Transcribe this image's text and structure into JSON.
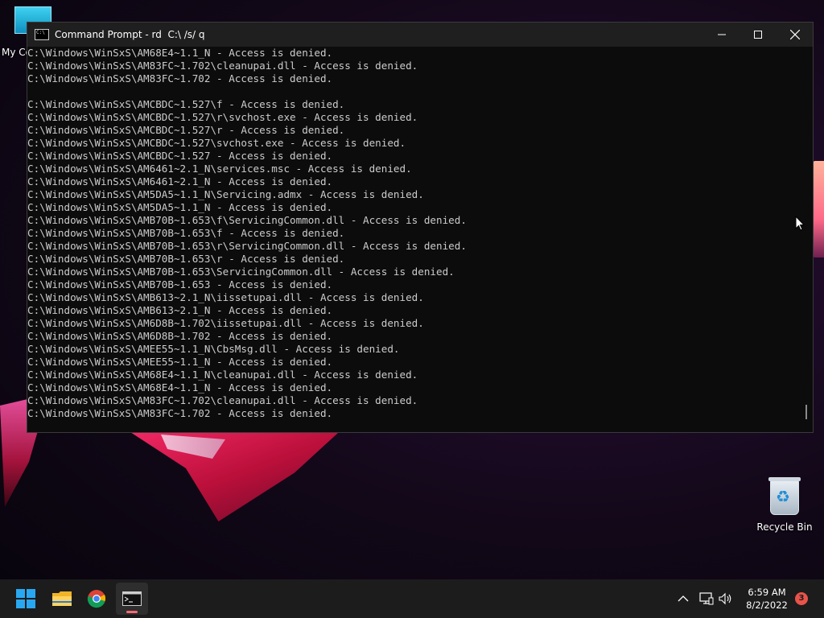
{
  "desktop": {
    "icons": [
      {
        "label": "My Co"
      },
      {
        "label": "Recycle Bin"
      }
    ]
  },
  "window": {
    "title": "Command Prompt - rd  C:\\ /s/ q",
    "console_lines": [
      "C:\\Windows\\WinSxS\\AM68E4~1.1_N - Access is denied.",
      "C:\\Windows\\WinSxS\\AM83FC~1.702\\cleanupai.dll - Access is denied.",
      "C:\\Windows\\WinSxS\\AM83FC~1.702 - Access is denied.",
      "",
      "C:\\Windows\\WinSxS\\AMCBDC~1.527\\f - Access is denied.",
      "C:\\Windows\\WinSxS\\AMCBDC~1.527\\r\\svchost.exe - Access is denied.",
      "C:\\Windows\\WinSxS\\AMCBDC~1.527\\r - Access is denied.",
      "C:\\Windows\\WinSxS\\AMCBDC~1.527\\svchost.exe - Access is denied.",
      "C:\\Windows\\WinSxS\\AMCBDC~1.527 - Access is denied.",
      "C:\\Windows\\WinSxS\\AM6461~2.1_N\\services.msc - Access is denied.",
      "C:\\Windows\\WinSxS\\AM6461~2.1_N - Access is denied.",
      "C:\\Windows\\WinSxS\\AM5DA5~1.1_N\\Servicing.admx - Access is denied.",
      "C:\\Windows\\WinSxS\\AM5DA5~1.1_N - Access is denied.",
      "C:\\Windows\\WinSxS\\AMB70B~1.653\\f\\ServicingCommon.dll - Access is denied.",
      "C:\\Windows\\WinSxS\\AMB70B~1.653\\f - Access is denied.",
      "C:\\Windows\\WinSxS\\AMB70B~1.653\\r\\ServicingCommon.dll - Access is denied.",
      "C:\\Windows\\WinSxS\\AMB70B~1.653\\r - Access is denied.",
      "C:\\Windows\\WinSxS\\AMB70B~1.653\\ServicingCommon.dll - Access is denied.",
      "C:\\Windows\\WinSxS\\AMB70B~1.653 - Access is denied.",
      "C:\\Windows\\WinSxS\\AMB613~2.1_N\\iissetupai.dll - Access is denied.",
      "C:\\Windows\\WinSxS\\AMB613~2.1_N - Access is denied.",
      "C:\\Windows\\WinSxS\\AM6D8B~1.702\\iissetupai.dll - Access is denied.",
      "C:\\Windows\\WinSxS\\AM6D8B~1.702 - Access is denied.",
      "C:\\Windows\\WinSxS\\AMEE55~1.1_N\\CbsMsg.dll - Access is denied.",
      "C:\\Windows\\WinSxS\\AMEE55~1.1_N - Access is denied.",
      "C:\\Windows\\WinSxS\\AM68E4~1.1_N\\cleanupai.dll - Access is denied.",
      "C:\\Windows\\WinSxS\\AM68E4~1.1_N - Access is denied.",
      "C:\\Windows\\WinSxS\\AM83FC~1.702\\cleanupai.dll - Access is denied.",
      "C:\\Windows\\WinSxS\\AM83FC~1.702 - Access is denied."
    ],
    "controls": {
      "minimize": "minimize-icon",
      "maximize": "maximize-icon",
      "close": "close-icon"
    }
  },
  "taskbar": {
    "apps": [
      {
        "name": "start",
        "icon": "windows-logo-icon"
      },
      {
        "name": "file-explorer",
        "icon": "folder-icon"
      },
      {
        "name": "chrome",
        "icon": "chrome-icon"
      },
      {
        "name": "command-prompt",
        "icon": "terminal-icon",
        "active": true
      }
    ],
    "tray": {
      "time": "6:59 AM",
      "date": "8/2/2022",
      "notification_count": "3"
    }
  },
  "colors": {
    "console_bg": "#0c0c0c",
    "console_text": "#cccccc",
    "titlebar": "#1f1f1f",
    "taskbar": "#1c1c1c",
    "notification": "#e8534a"
  }
}
